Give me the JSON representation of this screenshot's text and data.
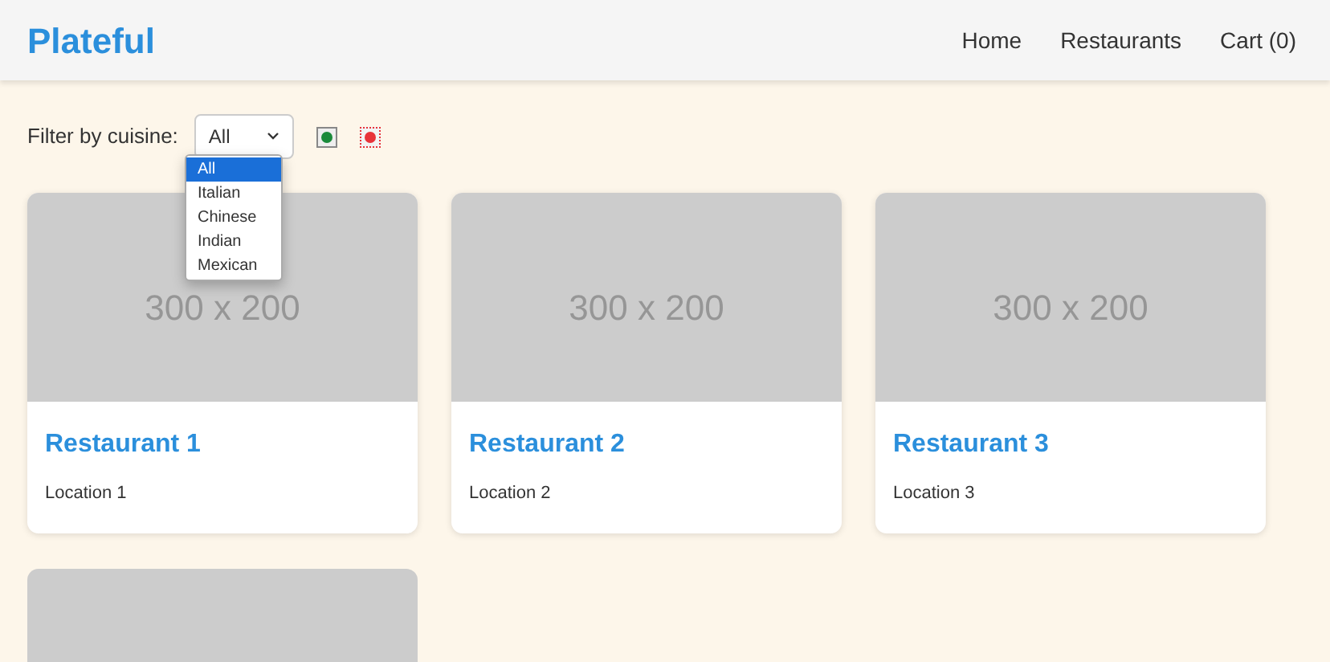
{
  "brand": "Plateful",
  "nav": [
    "Home",
    "Restaurants",
    "Cart (0)"
  ],
  "filter": {
    "label": "Filter by cuisine:",
    "value": "All",
    "options": [
      {
        "label": "All",
        "selected": true
      },
      {
        "label": "Italian",
        "selected": false
      },
      {
        "label": "Chinese",
        "selected": false
      },
      {
        "label": "Indian",
        "selected": false
      },
      {
        "label": "Mexican",
        "selected": false
      }
    ],
    "markers": [
      {
        "color": "#1a8a3a"
      },
      {
        "color": "#e8333a"
      }
    ]
  },
  "restaurants": [
    {
      "image_text": "300 x 200",
      "name": "Restaurant 1",
      "location": "Location 1"
    },
    {
      "image_text": "300 x 200",
      "name": "Restaurant 2",
      "location": "Location 2"
    },
    {
      "image_text": "300 x 200",
      "name": "Restaurant 3",
      "location": "Location 3"
    },
    {
      "kind": "partial"
    }
  ]
}
